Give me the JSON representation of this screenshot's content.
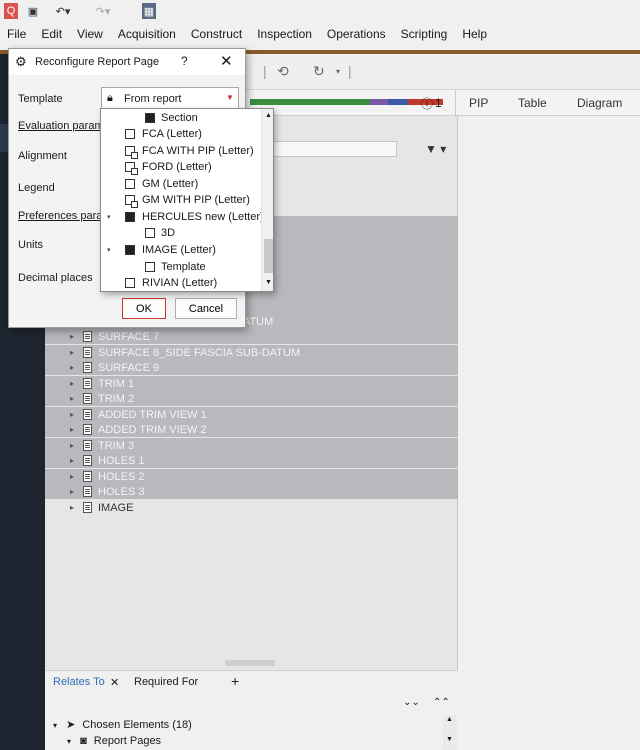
{
  "menubar": {
    "items": [
      "File",
      "Edit",
      "View",
      "Acquisition",
      "Construct",
      "Inspection",
      "Operations",
      "Scripting",
      "Help"
    ]
  },
  "header": {
    "counter": "1",
    "tabs": [
      "PIP",
      "Table",
      "Diagram"
    ]
  },
  "tree": {
    "rows": [
      {
        "label": "DATUM",
        "selected": true
      },
      {
        "label": "SURFACE 7",
        "selected": true
      },
      {
        "label": "SURFACE 8_SIDE FASCIA SUB-DATUM",
        "selected": true
      },
      {
        "label": "SURFACE 9",
        "selected": true
      },
      {
        "label": "TRIM 1",
        "selected": true
      },
      {
        "label": "TRIM 2",
        "selected": true
      },
      {
        "label": "ADDED TRIM VIEW 1",
        "selected": true
      },
      {
        "label": "ADDED TRIM VIEW 2",
        "selected": true
      },
      {
        "label": "TRIM 3",
        "selected": true
      },
      {
        "label": "HOLES 1",
        "selected": true
      },
      {
        "label": "HOLES 2",
        "selected": true
      },
      {
        "label": "HOLES 3",
        "selected": true
      },
      {
        "label": "IMAGE",
        "selected": false
      }
    ]
  },
  "bottom": {
    "tab_relates": "Relates To",
    "tab_required": "Required For",
    "add": "+",
    "chosen": "Chosen Elements (18)",
    "report_pages": "Report Pages"
  },
  "dialog": {
    "title": "Reconfigure Report Page",
    "help": "?",
    "close": "✕",
    "template_label": "Template",
    "template_value": "From report",
    "eval_label": "Evaluation param",
    "alignment_label": "Alignment",
    "legend_label": "Legend",
    "prefs_label": "Preferences paral",
    "units_label": "Units",
    "decimal_label": "Decimal places",
    "ok": "OK",
    "cancel": "Cancel"
  },
  "dropdown": {
    "items": [
      {
        "label": "Section",
        "icon": "section-icon",
        "indent": 2
      },
      {
        "label": "FCA (Letter)",
        "icon": "page-icon",
        "indent": 1
      },
      {
        "label": "FCA WITH PIP (Letter)",
        "icon": "page-pip-icon",
        "indent": 1
      },
      {
        "label": "FORD (Letter)",
        "icon": "page-icon",
        "indent": 1
      },
      {
        "label": "GM (Letter)",
        "icon": "page-icon",
        "indent": 1
      },
      {
        "label": "GM WITH PIP (Letter)",
        "icon": "page-pip-icon",
        "indent": 1
      },
      {
        "label": "HERCULES new (Letter)",
        "icon": "folder-icon",
        "indent": 1,
        "expanded": true
      },
      {
        "label": "3D",
        "icon": "page-icon",
        "indent": 2
      },
      {
        "label": "IMAGE (Letter)",
        "icon": "folder-icon",
        "indent": 1,
        "expanded": true
      },
      {
        "label": "Template",
        "icon": "page-icon",
        "indent": 2
      },
      {
        "label": "RIVIAN (Letter)",
        "icon": "page-icon",
        "indent": 1
      }
    ]
  },
  "colors": {
    "accent": "#8a5a2a",
    "selection": "#b8b8bd",
    "ok_border": "#c0392b"
  }
}
